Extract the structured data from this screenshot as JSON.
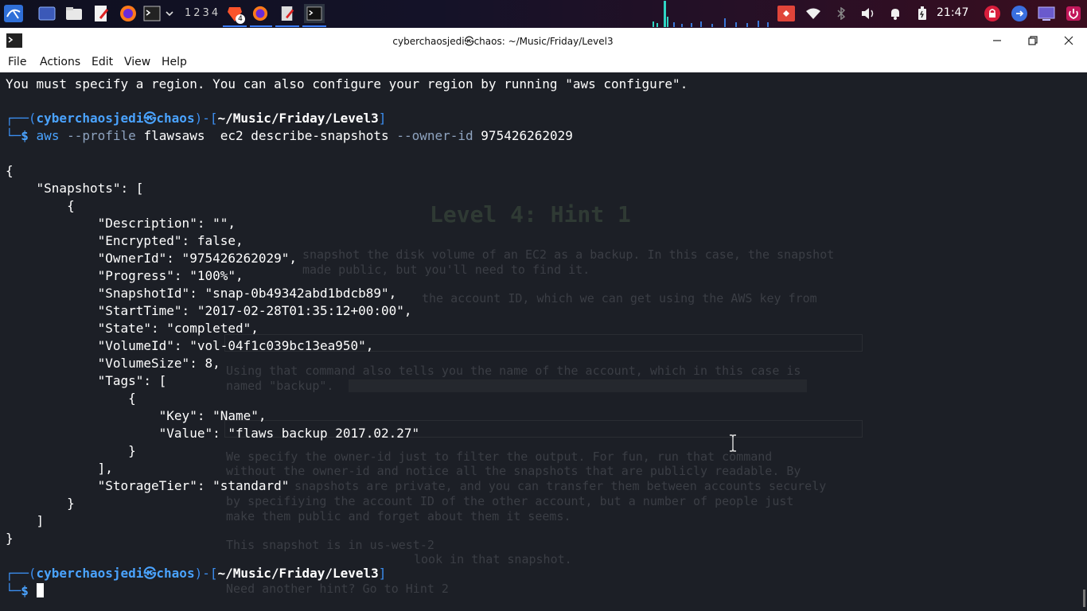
{
  "taskbar": {
    "workspaces": "1234",
    "badge": "4",
    "clock": "21:47"
  },
  "window": {
    "title": "cyberchaosjedi㉿chaos: ~/Music/Friday/Level3"
  },
  "menu": {
    "items": [
      "File",
      "Actions",
      "Edit",
      "View",
      "Help"
    ]
  },
  "terminal": {
    "error_line": "You must specify a region. You can also configure your region by running \"aws configure\".",
    "prompt": {
      "open": "┌──(",
      "user": "cyberchaosjedi",
      "at": "㉿",
      "host": "chaos",
      "mid": ")-[",
      "path": "~/Music/Friday/Level3",
      "close": "]",
      "corner": "└─",
      "dollar": "$"
    },
    "command": {
      "cmd": "aws",
      "opt1": "--profile",
      "arg1": "flawsaws",
      "rest": "  ec2 describe-snapshots",
      "opt2": "--owner-id",
      "arg2": "975426262029"
    },
    "output": [
      "{",
      "    \"Snapshots\": [",
      "        {",
      "            \"Description\": \"\",",
      "            \"Encrypted\": false,",
      "            \"OwnerId\": \"975426262029\",",
      "            \"Progress\": \"100%\",",
      "            \"SnapshotId\": \"snap-0b49342abd1bdcb89\",",
      "            \"StartTime\": \"2017-02-28T01:35:12+00:00\",",
      "            \"State\": \"completed\",",
      "            \"VolumeId\": \"vol-04f1c039bc13ea950\",",
      "            \"VolumeSize\": 8,",
      "            \"Tags\": [",
      "                {",
      "                    \"Key\": \"Name\",",
      "                    \"Value\": \"flaws backup 2017.02.27\"",
      "                }",
      "            ],",
      "            \"StorageTier\": \"standard\"",
      "        }",
      "    ]",
      "}"
    ]
  },
  "background_page": {
    "heading": "Level 4: Hint 1",
    "lines": [
      "snapshot the disk volume of an EC2 as a backup. In this case, the snapshot",
      "made public, but you'll need to find it.",
      "the account ID, which we can get using the AWS key from",
      "Using that command also tells you the name of the account, which in this case is",
      "named \"backup\".",
      "We specify the owner-id just to filter the output. For fun, run that command",
      "without the owner-id and notice all the snapshots that are publicly readable. By",
      "snapshots are private, and you can transfer them between accounts securely",
      "by specifiying the account ID of the other account, but a number of people just",
      "make them public and forget about them it seems.",
      "This snapshot is in us-west-2",
      "look in that snapshot.",
      "Need another hint? Go to Hint 2"
    ]
  }
}
